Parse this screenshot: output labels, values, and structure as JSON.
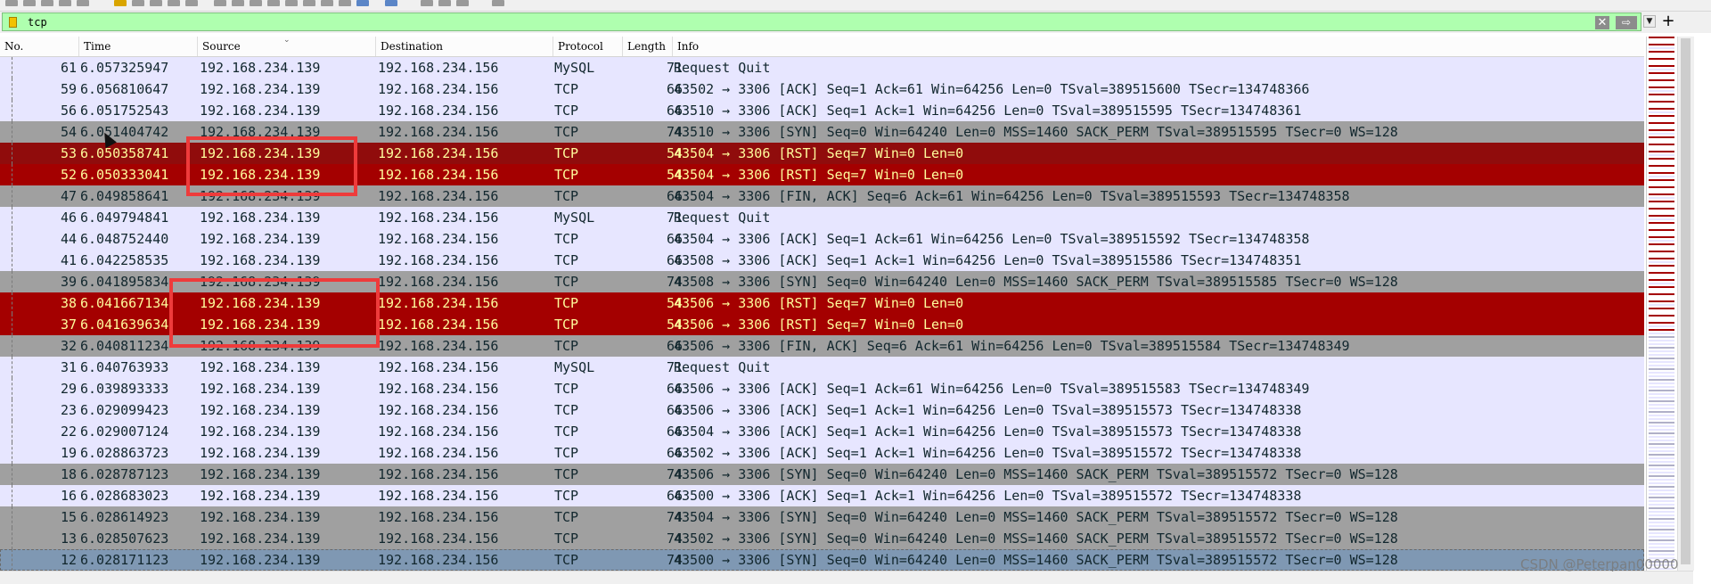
{
  "filter": {
    "value": "tcp"
  },
  "columns": [
    "No.",
    "Time",
    "Source",
    "Destination",
    "Protocol",
    "Length",
    "Info"
  ],
  "colors": {
    "normal_bg": "#e7e6ff",
    "normal_fg": "#12272e",
    "syn_bg": "#a0a0a0",
    "syn_fg": "#12272e",
    "rst_bg": "#a40000",
    "rst_fg": "#fffc9c",
    "selected_bg": "#7f98b3",
    "selected_fg": "#12272e",
    "annotation": "#ee3b3b"
  },
  "packets": [
    {
      "no": "61",
      "time": "6.057325947",
      "src": "192.168.234.139",
      "dst": "192.168.234.156",
      "proto": "MySQL",
      "len": "71",
      "info": "Request Quit",
      "style": "normal"
    },
    {
      "no": "59",
      "time": "6.056810647",
      "src": "192.168.234.139",
      "dst": "192.168.234.156",
      "proto": "TCP",
      "len": "66",
      "info": "43502 → 3306 [ACK] Seq=1 Ack=61 Win=64256 Len=0 TSval=389515600 TSecr=134748366",
      "style": "normal"
    },
    {
      "no": "56",
      "time": "6.051752543",
      "src": "192.168.234.139",
      "dst": "192.168.234.156",
      "proto": "TCP",
      "len": "66",
      "info": "43510 → 3306 [ACK] Seq=1 Ack=1 Win=64256 Len=0 TSval=389515595 TSecr=134748361",
      "style": "normal"
    },
    {
      "no": "54",
      "time": "6.051404742",
      "src": "192.168.234.139",
      "dst": "192.168.234.156",
      "proto": "TCP",
      "len": "74",
      "info": "43510 → 3306 [SYN] Seq=0 Win=64240 Len=0 MSS=1460 SACK_PERM TSval=389515595 TSecr=0 WS=128",
      "style": "syn"
    },
    {
      "no": "53",
      "time": "6.050358741",
      "src": "192.168.234.139",
      "dst": "192.168.234.156",
      "proto": "TCP",
      "len": "54",
      "info": "43504 → 3306 [RST] Seq=7 Win=0 Len=0",
      "style": "rst_dark"
    },
    {
      "no": "52",
      "time": "6.050333041",
      "src": "192.168.234.139",
      "dst": "192.168.234.156",
      "proto": "TCP",
      "len": "54",
      "info": "43504 → 3306 [RST] Seq=7 Win=0 Len=0",
      "style": "rst"
    },
    {
      "no": "47",
      "time": "6.049858641",
      "src": "192.168.234.139",
      "dst": "192.168.234.156",
      "proto": "TCP",
      "len": "66",
      "info": "43504 → 3306 [FIN, ACK] Seq=6 Ack=61 Win=64256 Len=0 TSval=389515593 TSecr=134748358",
      "style": "syn"
    },
    {
      "no": "46",
      "time": "6.049794841",
      "src": "192.168.234.139",
      "dst": "192.168.234.156",
      "proto": "MySQL",
      "len": "71",
      "info": "Request Quit",
      "style": "normal"
    },
    {
      "no": "44",
      "time": "6.048752440",
      "src": "192.168.234.139",
      "dst": "192.168.234.156",
      "proto": "TCP",
      "len": "66",
      "info": "43504 → 3306 [ACK] Seq=1 Ack=61 Win=64256 Len=0 TSval=389515592 TSecr=134748358",
      "style": "normal"
    },
    {
      "no": "41",
      "time": "6.042258535",
      "src": "192.168.234.139",
      "dst": "192.168.234.156",
      "proto": "TCP",
      "len": "66",
      "info": "43508 → 3306 [ACK] Seq=1 Ack=1 Win=64256 Len=0 TSval=389515586 TSecr=134748351",
      "style": "normal"
    },
    {
      "no": "39",
      "time": "6.041895834",
      "src": "192.168.234.139",
      "dst": "192.168.234.156",
      "proto": "TCP",
      "len": "74",
      "info": "43508 → 3306 [SYN] Seq=0 Win=64240 Len=0 MSS=1460 SACK_PERM TSval=389515585 TSecr=0 WS=128",
      "style": "syn"
    },
    {
      "no": "38",
      "time": "6.041667134",
      "src": "192.168.234.139",
      "dst": "192.168.234.156",
      "proto": "TCP",
      "len": "54",
      "info": "43506 → 3306 [RST] Seq=7 Win=0 Len=0",
      "style": "rst"
    },
    {
      "no": "37",
      "time": "6.041639634",
      "src": "192.168.234.139",
      "dst": "192.168.234.156",
      "proto": "TCP",
      "len": "54",
      "info": "43506 → 3306 [RST] Seq=7 Win=0 Len=0",
      "style": "rst"
    },
    {
      "no": "32",
      "time": "6.040811234",
      "src": "192.168.234.139",
      "dst": "192.168.234.156",
      "proto": "TCP",
      "len": "66",
      "info": "43506 → 3306 [FIN, ACK] Seq=6 Ack=61 Win=64256 Len=0 TSval=389515584 TSecr=134748349",
      "style": "syn"
    },
    {
      "no": "31",
      "time": "6.040763933",
      "src": "192.168.234.139",
      "dst": "192.168.234.156",
      "proto": "MySQL",
      "len": "71",
      "info": "Request Quit",
      "style": "normal"
    },
    {
      "no": "29",
      "time": "6.039893333",
      "src": "192.168.234.139",
      "dst": "192.168.234.156",
      "proto": "TCP",
      "len": "66",
      "info": "43506 → 3306 [ACK] Seq=1 Ack=61 Win=64256 Len=0 TSval=389515583 TSecr=134748349",
      "style": "normal"
    },
    {
      "no": "23",
      "time": "6.029099423",
      "src": "192.168.234.139",
      "dst": "192.168.234.156",
      "proto": "TCP",
      "len": "66",
      "info": "43506 → 3306 [ACK] Seq=1 Ack=1 Win=64256 Len=0 TSval=389515573 TSecr=134748338",
      "style": "normal"
    },
    {
      "no": "22",
      "time": "6.029007124",
      "src": "192.168.234.139",
      "dst": "192.168.234.156",
      "proto": "TCP",
      "len": "66",
      "info": "43504 → 3306 [ACK] Seq=1 Ack=1 Win=64256 Len=0 TSval=389515573 TSecr=134748338",
      "style": "normal"
    },
    {
      "no": "19",
      "time": "6.028863723",
      "src": "192.168.234.139",
      "dst": "192.168.234.156",
      "proto": "TCP",
      "len": "66",
      "info": "43502 → 3306 [ACK] Seq=1 Ack=1 Win=64256 Len=0 TSval=389515572 TSecr=134748338",
      "style": "normal"
    },
    {
      "no": "18",
      "time": "6.028787123",
      "src": "192.168.234.139",
      "dst": "192.168.234.156",
      "proto": "TCP",
      "len": "74",
      "info": "43506 → 3306 [SYN] Seq=0 Win=64240 Len=0 MSS=1460 SACK_PERM TSval=389515572 TSecr=0 WS=128",
      "style": "syn"
    },
    {
      "no": "16",
      "time": "6.028683023",
      "src": "192.168.234.139",
      "dst": "192.168.234.156",
      "proto": "TCP",
      "len": "66",
      "info": "43500 → 3306 [ACK] Seq=1 Ack=1 Win=64256 Len=0 TSval=389515572 TSecr=134748338",
      "style": "normal"
    },
    {
      "no": "15",
      "time": "6.028614923",
      "src": "192.168.234.139",
      "dst": "192.168.234.156",
      "proto": "TCP",
      "len": "74",
      "info": "43504 → 3306 [SYN] Seq=0 Win=64240 Len=0 MSS=1460 SACK_PERM TSval=389515572 TSecr=0 WS=128",
      "style": "syn"
    },
    {
      "no": "13",
      "time": "6.028507623",
      "src": "192.168.234.139",
      "dst": "192.168.234.156",
      "proto": "TCP",
      "len": "74",
      "info": "43502 → 3306 [SYN] Seq=0 Win=64240 Len=0 MSS=1460 SACK_PERM TSval=389515572 TSecr=0 WS=128",
      "style": "syn"
    },
    {
      "no": "12",
      "time": "6.028171123",
      "src": "192.168.234.139",
      "dst": "192.168.234.156",
      "proto": "TCP",
      "len": "74",
      "info": "43500 → 3306 [SYN] Seq=0 Win=64240 Len=0 MSS=1460 SACK_PERM TSval=389515572 TSecr=0 WS=128",
      "style": "selected"
    }
  ],
  "watermark": "CSDN @Peterpan00000"
}
